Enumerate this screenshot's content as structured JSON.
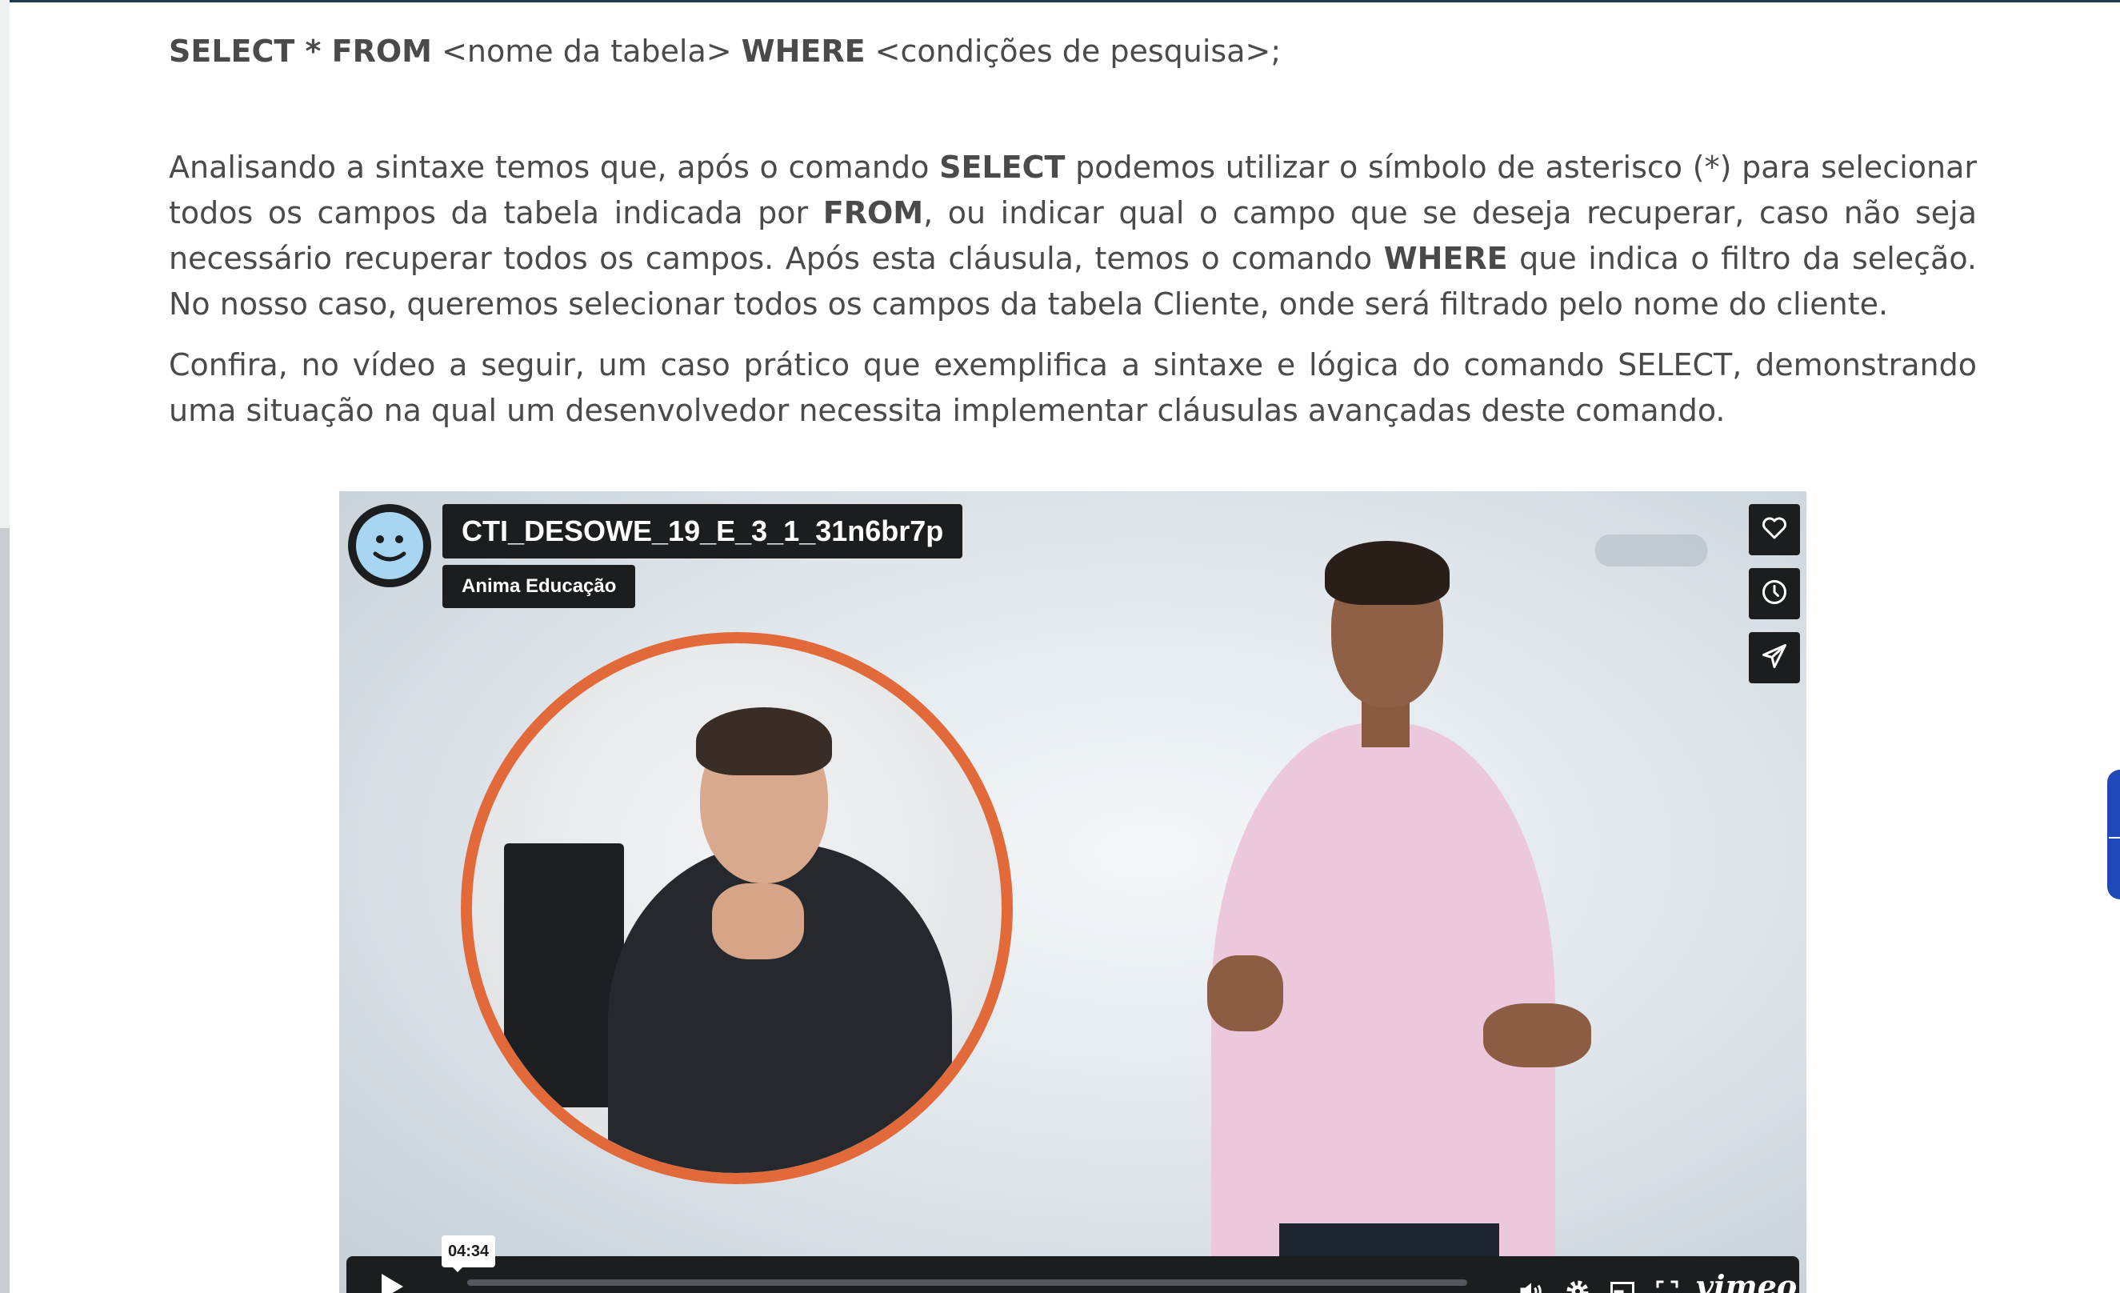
{
  "syntax": {
    "select": "SELECT * FROM",
    "table_placeholder": " <nome da tabela> ",
    "where": "WHERE",
    "conditions_placeholder": " <condições de pesquisa>;"
  },
  "paragraph1": {
    "t1": "Analisando a sintaxe temos que, após o comando ",
    "b1": "SELECT",
    "t2": " podemos utilizar o símbolo de asterisco (*) para selecionar todos os campos da tabela indicada por ",
    "b2": "FROM",
    "t3": ", ou indicar qual o campo que se deseja recuperar, caso não seja necessário recuperar todos os campos. Após esta cláusula, temos o comando ",
    "b3": "WHERE",
    "t4": " que indica o filtro da seleção. No nosso caso, queremos selecionar todos os campos da tabela Cliente, onde será filtrado pelo nome do cliente."
  },
  "paragraph2": "Confira, no vídeo a seguir, um caso prático que exemplifica a sintaxe e lógica do comando SELECT, demonstrando uma situação na qual um desenvolvedor necessita implementar cláusulas avançadas deste comando.",
  "video": {
    "title": "CTI_DESOWE_19_E_3_1_31n6br7p",
    "channel": "Anima Educação",
    "time_tooltip": "04:34",
    "brand": "vimeo",
    "progress": 0,
    "icons": [
      "heart-icon",
      "clock-icon",
      "send-icon",
      "play-icon",
      "volume-icon",
      "gear-icon",
      "picture-in-picture-icon",
      "fullscreen-icon"
    ]
  },
  "colors": {
    "text": "#4a4a4a",
    "player_chrome": "#1c1d1f",
    "ring": "#e26a3a",
    "accent_tab": "#2148b8"
  }
}
